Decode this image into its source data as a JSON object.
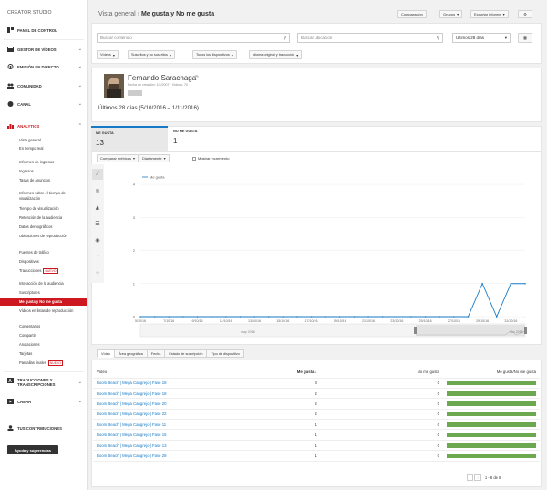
{
  "sidebar": {
    "studio": "CREATOR STUDIO",
    "sections": [
      {
        "label": "PANEL DE CONTROL",
        "icon": "dashboard-icon"
      },
      {
        "label": "GESTOR DE VÍDEOS",
        "icon": "video-manager-icon"
      },
      {
        "label": "EMISIÓN EN DIRECTO",
        "icon": "live-icon"
      },
      {
        "label": "COMUNIDAD",
        "icon": "community-icon"
      },
      {
        "label": "CANAL",
        "icon": "channel-icon"
      },
      {
        "label": "ANALYTICS",
        "icon": "analytics-icon"
      }
    ],
    "analytics_items": [
      "Vista general",
      "En tiempo real",
      "Informes de ingresos",
      "Ingresos",
      "Tasas de anuncios",
      "Informes sobre el tiempo de visualización",
      "Tiempo de visualización",
      "Retención de la audiencia",
      "Datos demográficos",
      "Ubicaciones de reproducción",
      "Fuentes de tráfico",
      "Dispositivos",
      "Traducciones",
      "Interacción de la audiencia",
      "Suscriptores",
      "Me gusta y No me gusta",
      "Vídeos en listas de reproducción",
      "Comentarios",
      "Compartir",
      "Anotaciones",
      "Tarjetas",
      "Pantallas finales"
    ],
    "nuevo": "NUEVO",
    "traducciones": "TRADUCCIONES Y TRANSCRIPCIONES",
    "crear": "CREAR",
    "contribuciones": "TUS CONTRIBUCIONES",
    "help": "Ayuda y sugerencias"
  },
  "header": {
    "crumb": "Vista general",
    "title": "Me gusta y No me gusta",
    "btn_compare": "Comparación",
    "btn_groups": "Grupos",
    "btn_export": "Exportar informe"
  },
  "search": {
    "content_placeholder": "Buscar contenido",
    "location_placeholder": "Buscar ubicación",
    "date_range": "Últimos 28 días"
  },
  "filters": [
    "Vídeos",
    "Suscritos y no suscritos",
    "Todos los dispositivos",
    "Idioma original y traducción"
  ],
  "channel": {
    "name": "Fernando Sarachaga",
    "meta": "Fecha de creación: 1/4/2007 · Vídeos: 70",
    "date_range": "Últimos 28 días (5/10/2016 – 1/11/2016)"
  },
  "metrics": [
    {
      "label": "ME GUSTA",
      "value": "13"
    },
    {
      "label": "NO ME GUSTA",
      "value": "1"
    }
  ],
  "chart_controls": {
    "compare": "Comparar métricas",
    "granularity": "Diariamente",
    "show_increment": "Mostrar incremento"
  },
  "chart_data": {
    "type": "line",
    "legend": "Me gusta",
    "x": [
      "5/10/16",
      "6/10/16",
      "7/10/16",
      "8/10/16",
      "9/10/16",
      "10/10/16",
      "11/10/16",
      "12/10/16",
      "13/10/16",
      "14/10/16",
      "15/10/16",
      "16/10/16",
      "17/10/16",
      "18/10/16",
      "19/10/16",
      "20/10/16",
      "21/10/16",
      "22/10/16",
      "23/10/16",
      "24/10/16",
      "25/10/16",
      "26/10/16",
      "27/10/16",
      "28/10/16",
      "29/10/16",
      "30/10/16",
      "31/10/16",
      "1/11/16"
    ],
    "series": [
      {
        "name": "Me gusta",
        "values": [
          0,
          0,
          0,
          0,
          0,
          0,
          0,
          0,
          0,
          0,
          0,
          0,
          0,
          0,
          0,
          0,
          0,
          0,
          0,
          0,
          0,
          0,
          0,
          0,
          1,
          0,
          1,
          1
        ]
      }
    ],
    "yticks": [
      "0",
      "1",
      "2",
      "3",
      "4",
      "1"
    ],
    "xticks": [
      "5/10/16",
      "7/10/16",
      "9/10/16",
      "11/10/16",
      "13/10/16",
      "15/10/16",
      "17/10/16",
      "19/10/16",
      "21/10/16",
      "23/10/16",
      "25/10/16",
      "27/10/16",
      "29/10/16",
      "31/10/16"
    ],
    "navigator": {
      "start": "may 2016",
      "end": "nov 2016"
    }
  },
  "table_tabs": [
    "Vídeo",
    "Área geográfica",
    "Fecha",
    "Estado de suscripción",
    "Tipo de dispositivo"
  ],
  "table": {
    "headers": {
      "video": "Vídeo",
      "likes": "Me gusta",
      "dislikes": "No me gusta",
      "ratio": "Me gusta/No me gusta"
    },
    "rows": [
      {
        "video": "Boom Beach | Mega Cangrejo | Fase 18",
        "likes": "3",
        "dislikes": "0",
        "ratio": 1
      },
      {
        "video": "Boom Beach | Mega Cangrejo | Fase 18",
        "likes": "2",
        "dislikes": "0",
        "ratio": 1
      },
      {
        "video": "Boom Beach | Mega Cangrejo | Fase 20",
        "likes": "2",
        "dislikes": "0",
        "ratio": 1
      },
      {
        "video": "Boom Beach | Mega Cangrejo | Fase 22",
        "likes": "2",
        "dislikes": "0",
        "ratio": 1
      },
      {
        "video": "Boom Beach | Mega Cangrejo | Fase 11",
        "likes": "1",
        "dislikes": "0",
        "ratio": 1
      },
      {
        "video": "Boom Beach | Mega Cangrejo | Fase 15",
        "likes": "1",
        "dislikes": "0",
        "ratio": 1
      },
      {
        "video": "Boom Beach | Mega Cangrejo | Fase 13",
        "likes": "1",
        "dislikes": "0",
        "ratio": 1
      },
      {
        "video": "Boom Beach | Mega Cangrejo | Fase 28",
        "likes": "1",
        "dislikes": "0",
        "ratio": 1
      }
    ],
    "pagination": "1 - 8 de 8"
  }
}
